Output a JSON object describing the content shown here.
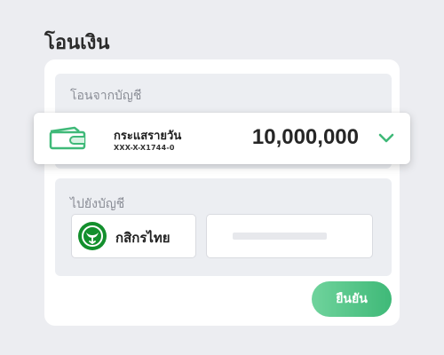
{
  "header": {
    "title": "โอนเงิน"
  },
  "from": {
    "label": "โอนจากบัญชี",
    "account_name": "กระแสรายวัน",
    "account_number": "XXX-X-X1744-0",
    "balance": "10,000,000",
    "icon": "wallet-icon",
    "chevron_icon": "chevron-down-icon"
  },
  "to": {
    "label": "ไปยังบัญชี",
    "bank_name": "กสิกรไทย",
    "bank_icon": "kbank-logo-icon",
    "account_input_value": ""
  },
  "actions": {
    "confirm_label": "ยืนยัน"
  },
  "colors": {
    "accent": "#3fb978",
    "accent_light": "#6fd39c",
    "bank_green": "#138f2d",
    "background": "#ecedf1",
    "section_background": "#eceef2"
  }
}
